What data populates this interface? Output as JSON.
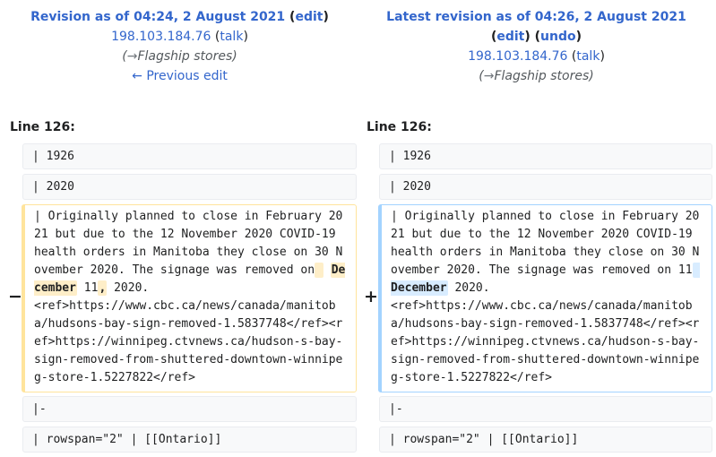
{
  "left_header": {
    "title_prefix": "Revision as of 04:24, 2 August 2021",
    "edit_label": "edit",
    "user": "198.103.184.76",
    "talk_label": "talk",
    "summary_arrow": "→",
    "summary_section": "Flagship stores",
    "prev_edit_label": "← Previous edit"
  },
  "right_header": {
    "title_prefix": "Latest revision as of 04:26, 2 August 2021",
    "edit_label": "edit",
    "undo_label": "undo",
    "user": "198.103.184.76",
    "talk_label": "talk",
    "summary_arrow": "→",
    "summary_section": "Flagship stores"
  },
  "line_label_left": "Line 126:",
  "line_label_right": "Line 126:",
  "context_rows_before": [
    "| 1926",
    "| 2020"
  ],
  "changed": {
    "marker_del": "−",
    "marker_add": "+",
    "common_start": "| Originally planned to close in February 2021 but due to the 12 November 2020 COVID-19 health orders in Manitoba they close on 30 November 2020. The signage was removed on",
    "left_hl_1": " ",
    "left_hl_2": "December",
    "left_mid": " 11",
    "left_hl_3": ",",
    "left_after": " 2020.",
    "right_mid": " 11",
    "right_hl": " December",
    "right_after": " 2020.",
    "common_end": "<ref>https://www.cbc.ca/news/canada/manitoba/hudsons-bay-sign-removed-1.5837748</ref><ref>https://winnipeg.ctvnews.ca/hudson-s-bay-sign-removed-from-shuttered-downtown-winnipeg-store-1.5227822</ref>"
  },
  "context_rows_after": [
    "|-",
    "| rowspan=\"2\" | [[Ontario]]"
  ]
}
